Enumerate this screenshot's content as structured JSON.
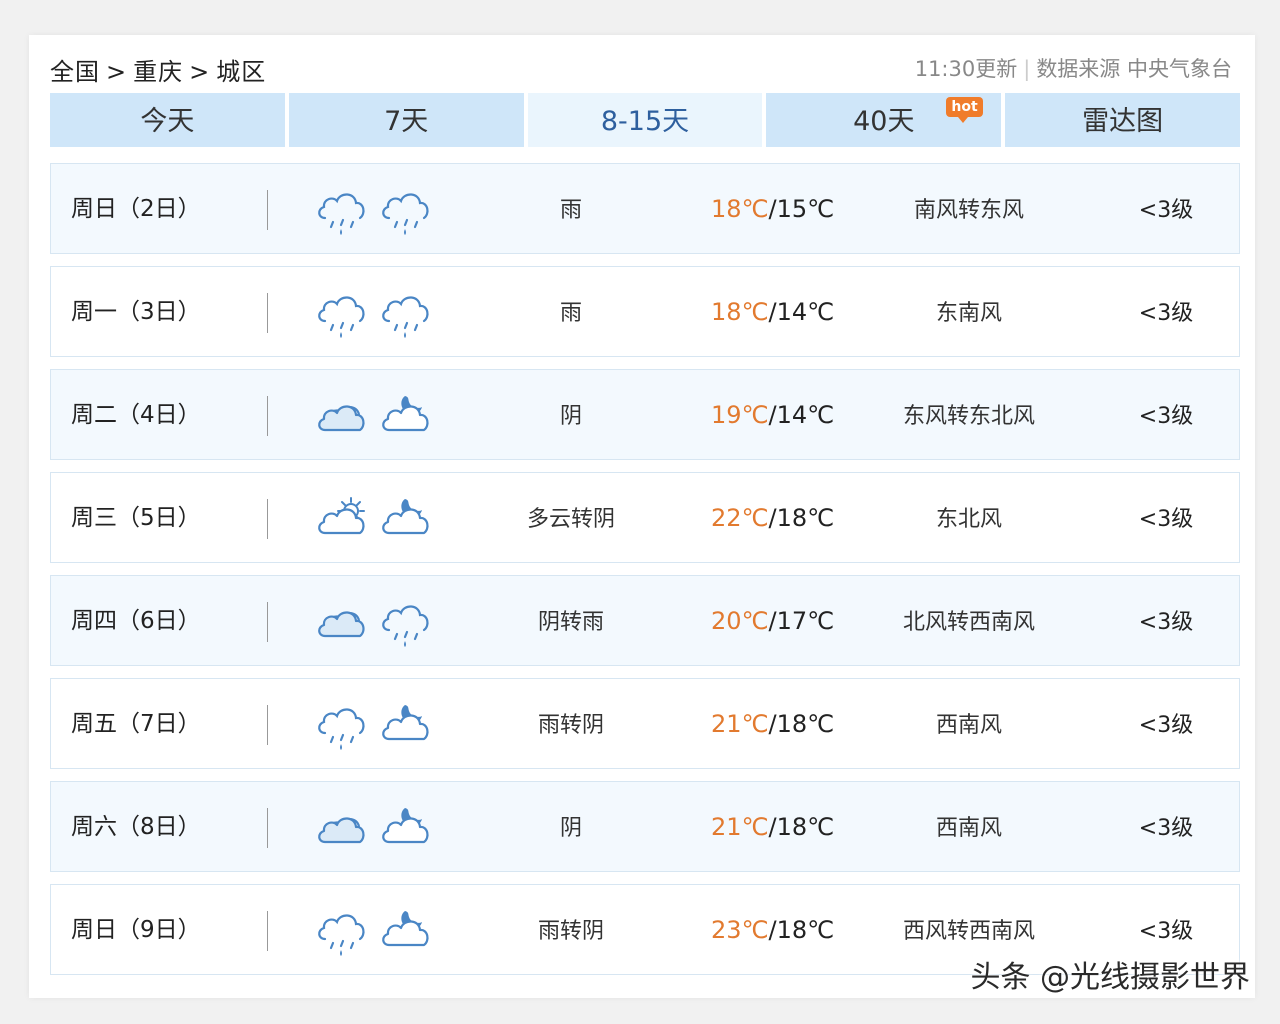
{
  "breadcrumb": {
    "country": "全国",
    "sep": ">",
    "city": "重庆",
    "district": "城区"
  },
  "update": {
    "time": "11:30更新",
    "source": "数据来源 中央气象台"
  },
  "tabs": [
    {
      "label": "今天"
    },
    {
      "label": "7天"
    },
    {
      "label": "8-15天"
    },
    {
      "label": "40天",
      "badge": "hot"
    },
    {
      "label": "雷达图"
    }
  ],
  "forecast": [
    {
      "day": "周日（2日）",
      "icon_day": "rain-cloud-icon",
      "icon_night": "rain-cloud-icon",
      "desc": "雨",
      "high": "18℃",
      "low": "/15℃",
      "wind": "南风转东风",
      "level": "<3级"
    },
    {
      "day": "周一（3日）",
      "icon_day": "rain-cloud-icon",
      "icon_night": "rain-cloud-icon",
      "desc": "雨",
      "high": "18℃",
      "low": "/14℃",
      "wind": "东南风",
      "level": "<3级"
    },
    {
      "day": "周二（4日）",
      "icon_day": "overcast-icon",
      "icon_night": "cloudy-night-icon",
      "desc": "阴",
      "high": "19℃",
      "low": "/14℃",
      "wind": "东风转东北风",
      "level": "<3级"
    },
    {
      "day": "周三（5日）",
      "icon_day": "partly-cloudy-day-icon",
      "icon_night": "cloudy-night-icon",
      "desc": "多云转阴",
      "high": "22℃",
      "low": "/18℃",
      "wind": "东北风",
      "level": "<3级"
    },
    {
      "day": "周四（6日）",
      "icon_day": "overcast-icon",
      "icon_night": "rain-cloud-icon",
      "desc": "阴转雨",
      "high": "20℃",
      "low": "/17℃",
      "wind": "北风转西南风",
      "level": "<3级"
    },
    {
      "day": "周五（7日）",
      "icon_day": "rain-cloud-icon",
      "icon_night": "cloudy-night-icon",
      "desc": "雨转阴",
      "high": "21℃",
      "low": "/18℃",
      "wind": "西南风",
      "level": "<3级"
    },
    {
      "day": "周六（8日）",
      "icon_day": "overcast-icon",
      "icon_night": "cloudy-night-icon",
      "desc": "阴",
      "high": "21℃",
      "low": "/18℃",
      "wind": "西南风",
      "level": "<3级"
    },
    {
      "day": "周日（9日）",
      "icon_day": "rain-cloud-icon",
      "icon_night": "cloudy-night-icon",
      "desc": "雨转阴",
      "high": "23℃",
      "low": "/18℃",
      "wind": "西风转西南风",
      "level": "<3级"
    }
  ],
  "watermark": "头条 @光线摄影世界",
  "colors": {
    "tab_bg": "#cfe6f9",
    "tab_active_bg": "#eaf5fd",
    "tab_active_text": "#2e5f9e",
    "high_temp": "#e27a2f",
    "icon_stroke": "#4a86c5",
    "hot_badge": "#f07c2b"
  }
}
